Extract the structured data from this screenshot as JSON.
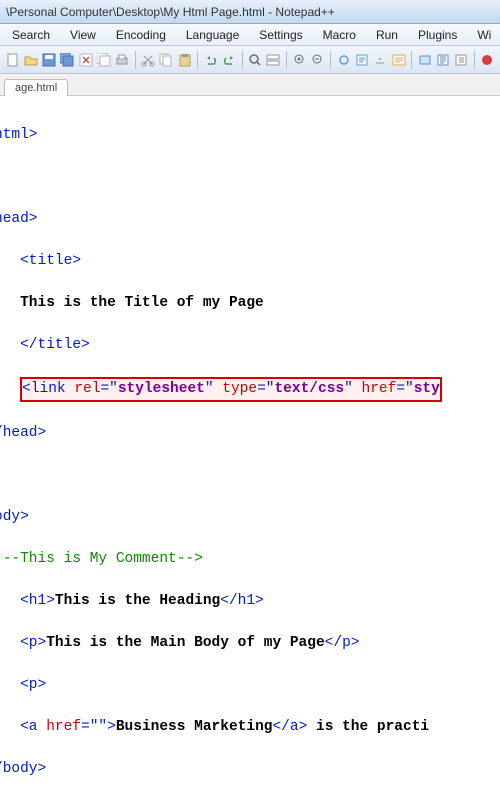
{
  "window": {
    "title": "\\Personal Computer\\Desktop\\My Html Page.html - Notepad++"
  },
  "menu": {
    "items": [
      "Search",
      "View",
      "Encoding",
      "Language",
      "Settings",
      "Macro",
      "Run",
      "Plugins",
      "Wi"
    ]
  },
  "tab": {
    "label": "age.html"
  },
  "code": {
    "l1_tag": "html>",
    "l2_tag": "head>",
    "l3_open": "<title>",
    "l4_text": "This is the Title of my Page",
    "l5_close": "</title>",
    "link_open": "<link ",
    "link_rel_attr": "rel",
    "link_rel_eq": "=\"",
    "link_rel_val": "stylesheet",
    "link_rel_close": "\" ",
    "link_type_attr": "type",
    "link_type_eq": "=\"",
    "link_type_val": "text/css",
    "link_type_close": "\" ",
    "link_href_attr": "href",
    "link_href_eq": "=\"",
    "link_href_val": "sty",
    "l7_tag": "/head>",
    "l8_tag": "ody>",
    "l9_comment": "!--This is My Comment-->",
    "l10_open": "<h1>",
    "l10_text": "This is the Heading",
    "l10_close": "</h1>",
    "l11_open": "<p>",
    "l11_text": "This is the Main Body of my Page",
    "l11_close": "</p>",
    "l12_p": "<p>",
    "l13_a_open": "<a ",
    "l13_href_attr": "href",
    "l13_href_eq": "=\"\">",
    "l13_a_text": "Business Marketing",
    "l13_a_close": "</a>",
    "l13_tail": " is the practi",
    "l14_tag": "/body>"
  }
}
